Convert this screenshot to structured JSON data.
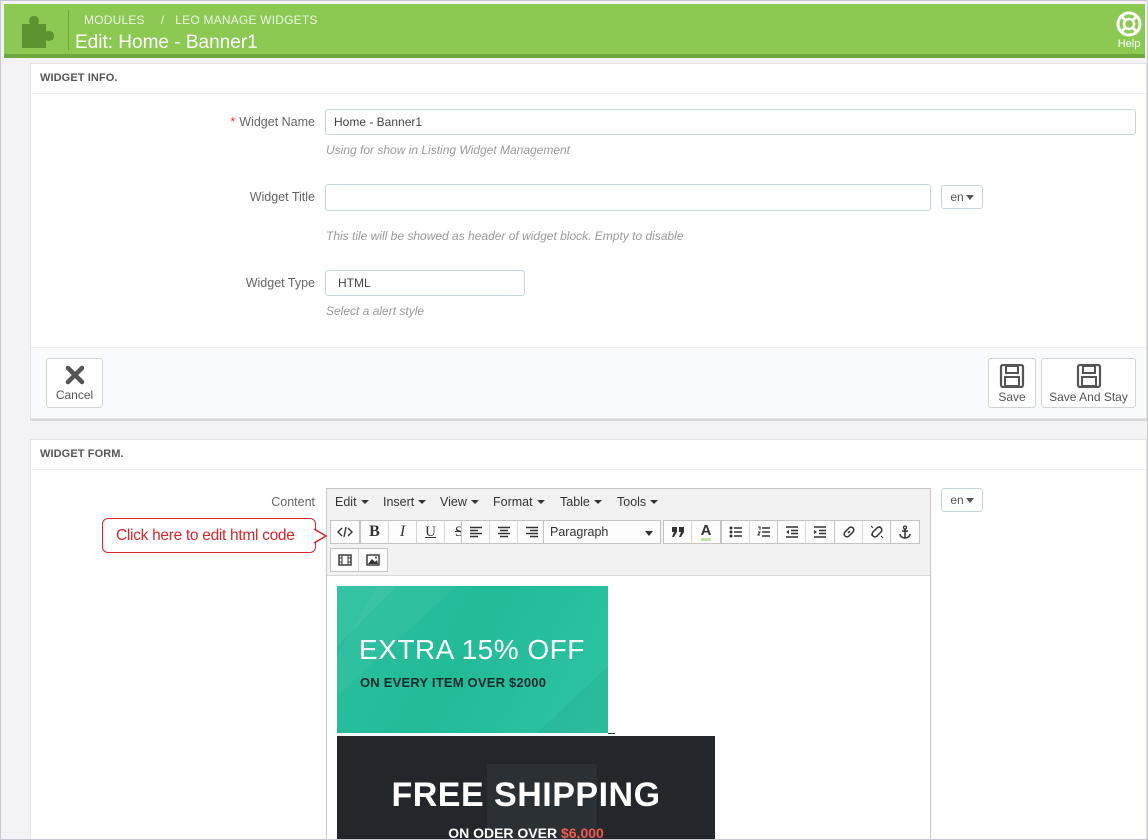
{
  "header": {
    "breadcrumb": [
      "MODULES",
      "LEO MANAGE WIDGETS"
    ],
    "breadcrumb_separator": "/",
    "title": "Edit: Home - Banner1",
    "help_label": "Help",
    "logo_icon": "puzzle-icon",
    "brand_color": "#8bc952"
  },
  "widget_info": {
    "heading": "WIDGET INFO.",
    "name": {
      "required_mark": "*",
      "label": "Widget Name",
      "value": "Home - Banner1",
      "help": "Using for show in Listing Widget Management"
    },
    "title": {
      "label": "Widget Title",
      "value": "",
      "lang": "en",
      "help": "This tile will be showed as header of widget block. Empty to disable"
    },
    "type": {
      "label": "Widget Type",
      "value": "HTML",
      "help": "Select a alert style"
    },
    "buttons": {
      "cancel": "Cancel",
      "save": "Save",
      "save_stay": "Save And Stay"
    }
  },
  "widget_form": {
    "heading": "WIDGET FORM.",
    "content_label": "Content",
    "lang": "en",
    "menu": [
      "Edit",
      "Insert",
      "View",
      "Format",
      "Table",
      "Tools"
    ],
    "format_value": "Paragraph",
    "toolbar_icons": [
      "source-code-icon",
      "bold-icon",
      "italic-icon",
      "underline-icon",
      "strikethrough-icon",
      "align-left-icon",
      "align-center-icon",
      "align-right-icon",
      "blockquote-icon",
      "text-color-icon",
      "bullet-list-icon",
      "numbered-list-icon",
      "outdent-icon",
      "indent-icon",
      "link-icon",
      "unlink-icon",
      "anchor-icon",
      "media-icon",
      "image-icon"
    ],
    "bold_glyph": "B",
    "italic_glyph": "I",
    "underline_glyph": "U",
    "strike_glyph": "S",
    "color_glyph": "A",
    "banner1": {
      "line1": "EXTRA 15% OFF",
      "line2": "ON EVERY ITEM OVER $2000",
      "bg_color": "#22bb98"
    },
    "banner2": {
      "line1": "FREE SHIPPING",
      "line2_prefix": "ON ODER OVER ",
      "line2_highlight": "$6,000",
      "bg_color": "#23272b",
      "highlight_color": "#f05a4e"
    }
  },
  "callout": {
    "text": "Click here to edit html code",
    "color": "#d9262a"
  }
}
